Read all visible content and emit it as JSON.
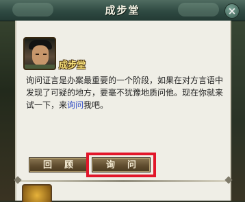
{
  "window": {
    "title": "成步堂",
    "close_glyph": "×"
  },
  "npc": {
    "name": "成步堂",
    "portrait": "character-portrait"
  },
  "dialog": {
    "text_before_link": "询问证言是办案最重要的一个阶段，如果在对方言语中发现了可疑的地方，要毫不犹豫地质问他。现在你就来试一下，来",
    "link_text": "询问",
    "text_after_link": "我吧。"
  },
  "buttons": {
    "back_label": "回顾",
    "ask_label": "询问"
  },
  "colors": {
    "highlight": "#e2162a",
    "link": "#2f4cc4",
    "name": "#f7e07a"
  }
}
